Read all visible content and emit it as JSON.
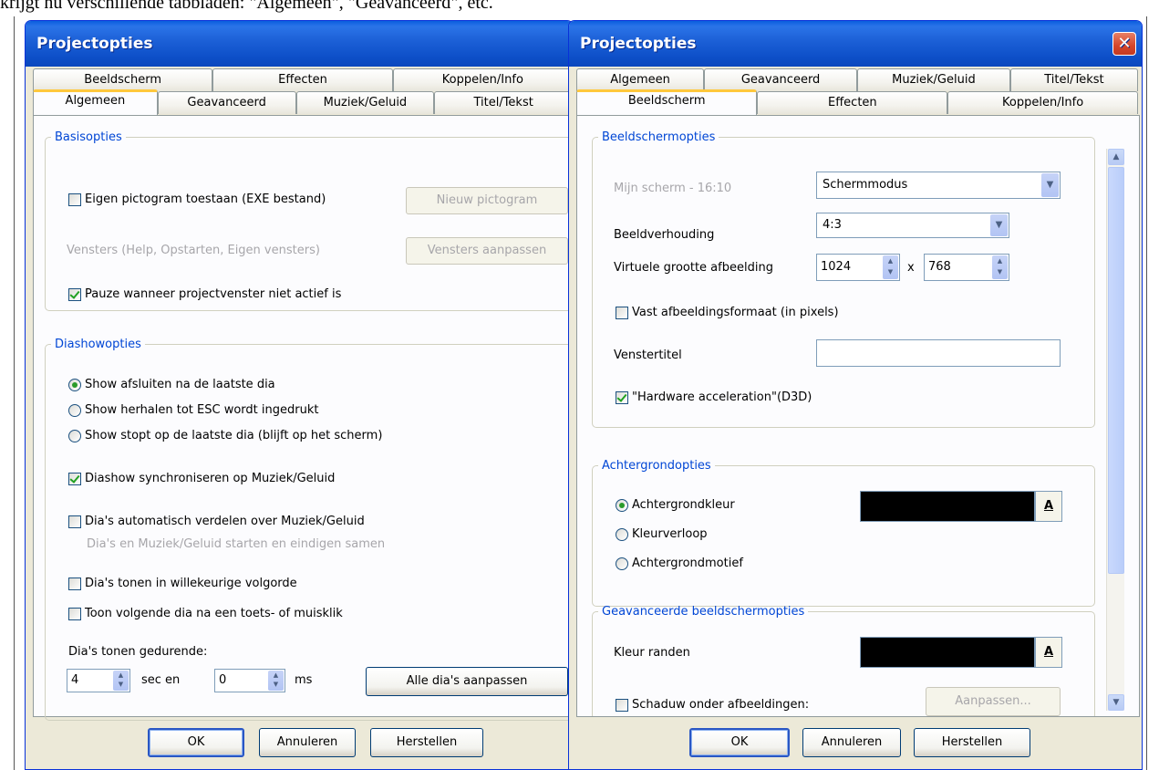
{
  "doc_caption": "krijgt nu verschillende tabbladen: \"Algemeen\", \"Geavanceerd\", etc.",
  "left_dialog": {
    "title": "Projectopties",
    "tabs_back": [
      "Beeldscherm",
      "Effecten",
      "Koppelen/Info"
    ],
    "tabs_front": [
      "Algemeen",
      "Geavanceerd",
      "Muziek/Geluid",
      "Titel/Tekst"
    ],
    "basis": {
      "legend": "Basisopties",
      "own_icon": "Eigen pictogram toestaan (EXE bestand)",
      "new_icon_btn": "Nieuw pictogram",
      "windows_label": "Vensters (Help, Opstarten, Eigen vensters)",
      "windows_btn": "Vensters aanpassen",
      "pause": "Pauze wanneer projectvenster niet actief is"
    },
    "slideshow": {
      "legend": "Diashowopties",
      "radio1": "Show afsluiten na de laatste dia",
      "radio2": "Show herhalen tot ESC wordt ingedrukt",
      "radio3": "Show stopt op de laatste dia (blijft op het scherm)",
      "sync": "Diashow synchroniseren op Muziek/Geluid",
      "distribute": "Dia's automatisch verdelen over Muziek/Geluid",
      "distribute_hint": "Dia's en Muziek/Geluid starten en eindigen samen",
      "random": "Dia's tonen in willekeurige volgorde",
      "next_on_key": "Toon volgende dia na een toets- of muisklik",
      "duration_label": "Dia's tonen gedurende:",
      "sec_value": "4",
      "sec_label": "sec en",
      "ms_value": "0",
      "ms_label": "ms",
      "adjust_all_btn": "Alle dia's aanpassen"
    },
    "footer": {
      "ok": "OK",
      "cancel": "Annuleren",
      "reset": "Herstellen"
    }
  },
  "right_dialog": {
    "title": "Projectopties",
    "close_glyph": "✕",
    "tabs_back": [
      "Algemeen",
      "Geavanceerd",
      "Muziek/Geluid",
      "Titel/Tekst"
    ],
    "tabs_front": [
      "Beeldscherm",
      "Effecten",
      "Koppelen/Info"
    ],
    "screen": {
      "legend": "Beeldschermopties",
      "my_screen": "Mijn scherm - 16:10",
      "mode_select": "Schermmodus",
      "aspect_label": "Beeldverhouding",
      "aspect_value": "4:3",
      "virtual_label": "Virtuele grootte afbeelding",
      "width_value": "1024",
      "times": "x",
      "height_value": "768",
      "fixed_size": "Vast afbeeldingsformaat (in pixels)",
      "window_title_label": "Venstertitel",
      "window_title_value": "",
      "hw_accel": "\"Hardware acceleration\"(D3D)"
    },
    "background": {
      "legend": "Achtergrondopties",
      "radio_color": "Achtergrondkleur",
      "radio_gradient": "Kleurverloop",
      "radio_pattern": "Achtergrondmotief",
      "color_btn": "A",
      "color": "#000000"
    },
    "advanced": {
      "legend": "Geavanceerde beeldschermopties",
      "border_color_label": "Kleur randen",
      "color_btn": "A",
      "color": "#000000",
      "shadow": "Schaduw onder afbeeldingen:",
      "adjust_btn": "Aanpassen..."
    },
    "footer": {
      "ok": "OK",
      "cancel": "Annuleren",
      "reset": "Herstellen"
    }
  },
  "colors": {
    "titlebar": "#0b47be",
    "dialog_bg": "#ece9d8",
    "group_legend": "#0046d5",
    "active_tab_accent": "#ffc83c"
  },
  "icons": {
    "dropdown": "chevron-down-icon",
    "spin": "spin-arrows-icon",
    "scroll_up": "arrow-up-icon",
    "scroll_down": "arrow-down-icon",
    "close": "close-icon"
  }
}
